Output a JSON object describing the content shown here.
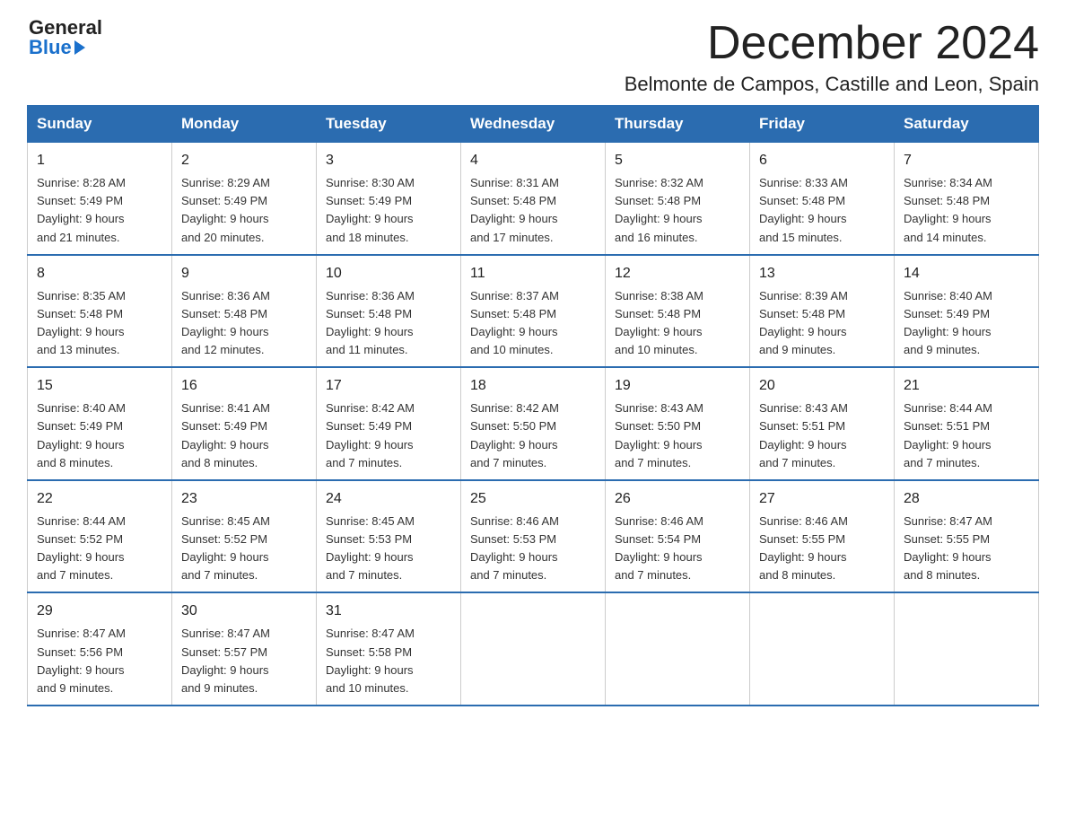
{
  "header": {
    "logo_general": "General",
    "logo_blue": "Blue",
    "month_title": "December 2024",
    "location": "Belmonte de Campos, Castille and Leon, Spain"
  },
  "days_of_week": [
    "Sunday",
    "Monday",
    "Tuesday",
    "Wednesday",
    "Thursday",
    "Friday",
    "Saturday"
  ],
  "weeks": [
    [
      {
        "day": "1",
        "sunrise": "8:28 AM",
        "sunset": "5:49 PM",
        "daylight": "9 hours and 21 minutes."
      },
      {
        "day": "2",
        "sunrise": "8:29 AM",
        "sunset": "5:49 PM",
        "daylight": "9 hours and 20 minutes."
      },
      {
        "day": "3",
        "sunrise": "8:30 AM",
        "sunset": "5:49 PM",
        "daylight": "9 hours and 18 minutes."
      },
      {
        "day": "4",
        "sunrise": "8:31 AM",
        "sunset": "5:48 PM",
        "daylight": "9 hours and 17 minutes."
      },
      {
        "day": "5",
        "sunrise": "8:32 AM",
        "sunset": "5:48 PM",
        "daylight": "9 hours and 16 minutes."
      },
      {
        "day": "6",
        "sunrise": "8:33 AM",
        "sunset": "5:48 PM",
        "daylight": "9 hours and 15 minutes."
      },
      {
        "day": "7",
        "sunrise": "8:34 AM",
        "sunset": "5:48 PM",
        "daylight": "9 hours and 14 minutes."
      }
    ],
    [
      {
        "day": "8",
        "sunrise": "8:35 AM",
        "sunset": "5:48 PM",
        "daylight": "9 hours and 13 minutes."
      },
      {
        "day": "9",
        "sunrise": "8:36 AM",
        "sunset": "5:48 PM",
        "daylight": "9 hours and 12 minutes."
      },
      {
        "day": "10",
        "sunrise": "8:36 AM",
        "sunset": "5:48 PM",
        "daylight": "9 hours and 11 minutes."
      },
      {
        "day": "11",
        "sunrise": "8:37 AM",
        "sunset": "5:48 PM",
        "daylight": "9 hours and 10 minutes."
      },
      {
        "day": "12",
        "sunrise": "8:38 AM",
        "sunset": "5:48 PM",
        "daylight": "9 hours and 10 minutes."
      },
      {
        "day": "13",
        "sunrise": "8:39 AM",
        "sunset": "5:48 PM",
        "daylight": "9 hours and 9 minutes."
      },
      {
        "day": "14",
        "sunrise": "8:40 AM",
        "sunset": "5:49 PM",
        "daylight": "9 hours and 9 minutes."
      }
    ],
    [
      {
        "day": "15",
        "sunrise": "8:40 AM",
        "sunset": "5:49 PM",
        "daylight": "9 hours and 8 minutes."
      },
      {
        "day": "16",
        "sunrise": "8:41 AM",
        "sunset": "5:49 PM",
        "daylight": "9 hours and 8 minutes."
      },
      {
        "day": "17",
        "sunrise": "8:42 AM",
        "sunset": "5:49 PM",
        "daylight": "9 hours and 7 minutes."
      },
      {
        "day": "18",
        "sunrise": "8:42 AM",
        "sunset": "5:50 PM",
        "daylight": "9 hours and 7 minutes."
      },
      {
        "day": "19",
        "sunrise": "8:43 AM",
        "sunset": "5:50 PM",
        "daylight": "9 hours and 7 minutes."
      },
      {
        "day": "20",
        "sunrise": "8:43 AM",
        "sunset": "5:51 PM",
        "daylight": "9 hours and 7 minutes."
      },
      {
        "day": "21",
        "sunrise": "8:44 AM",
        "sunset": "5:51 PM",
        "daylight": "9 hours and 7 minutes."
      }
    ],
    [
      {
        "day": "22",
        "sunrise": "8:44 AM",
        "sunset": "5:52 PM",
        "daylight": "9 hours and 7 minutes."
      },
      {
        "day": "23",
        "sunrise": "8:45 AM",
        "sunset": "5:52 PM",
        "daylight": "9 hours and 7 minutes."
      },
      {
        "day": "24",
        "sunrise": "8:45 AM",
        "sunset": "5:53 PM",
        "daylight": "9 hours and 7 minutes."
      },
      {
        "day": "25",
        "sunrise": "8:46 AM",
        "sunset": "5:53 PM",
        "daylight": "9 hours and 7 minutes."
      },
      {
        "day": "26",
        "sunrise": "8:46 AM",
        "sunset": "5:54 PM",
        "daylight": "9 hours and 7 minutes."
      },
      {
        "day": "27",
        "sunrise": "8:46 AM",
        "sunset": "5:55 PM",
        "daylight": "9 hours and 8 minutes."
      },
      {
        "day": "28",
        "sunrise": "8:47 AM",
        "sunset": "5:55 PM",
        "daylight": "9 hours and 8 minutes."
      }
    ],
    [
      {
        "day": "29",
        "sunrise": "8:47 AM",
        "sunset": "5:56 PM",
        "daylight": "9 hours and 9 minutes."
      },
      {
        "day": "30",
        "sunrise": "8:47 AM",
        "sunset": "5:57 PM",
        "daylight": "9 hours and 9 minutes."
      },
      {
        "day": "31",
        "sunrise": "8:47 AM",
        "sunset": "5:58 PM",
        "daylight": "9 hours and 10 minutes."
      },
      null,
      null,
      null,
      null
    ]
  ],
  "labels": {
    "sunrise": "Sunrise:",
    "sunset": "Sunset:",
    "daylight": "Daylight:"
  }
}
